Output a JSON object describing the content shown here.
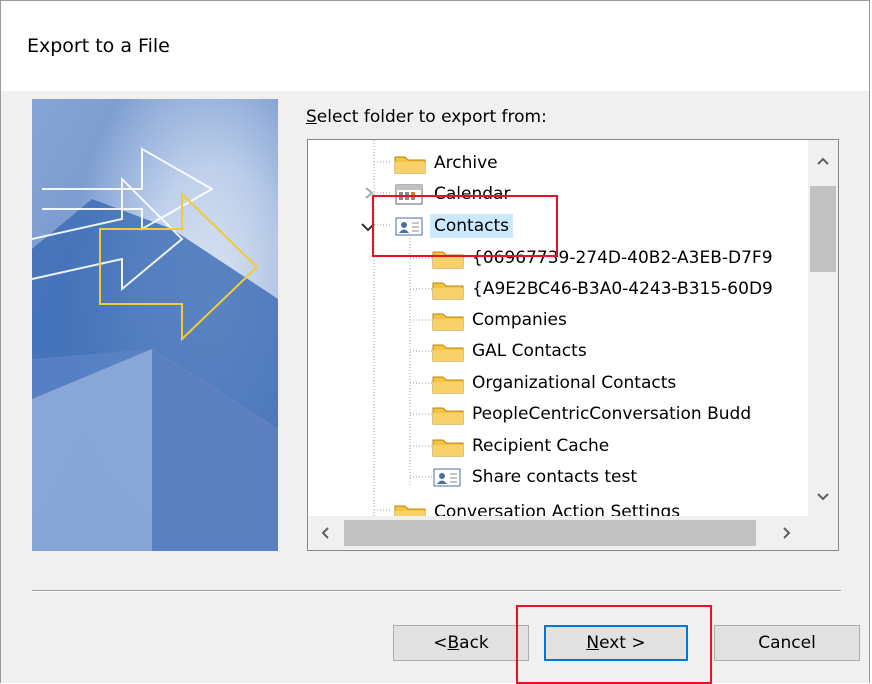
{
  "dialog": {
    "title": "Export to a File",
    "prompt_underlined": "S",
    "prompt_rest": "elect folder to export from:"
  },
  "tree": {
    "items": [
      {
        "label": "Archive",
        "icon": "folder-icon"
      },
      {
        "label": "Calendar",
        "icon": "calendar-icon"
      },
      {
        "label": "Contacts",
        "icon": "contacts-icon",
        "selected": true,
        "expanded": true
      },
      {
        "label": "{06967739-274D-40B2-A3EB-D7F9",
        "icon": "folder-icon"
      },
      {
        "label": "{A9E2BC46-B3A0-4243-B315-60D9",
        "icon": "folder-icon"
      },
      {
        "label": "Companies",
        "icon": "folder-icon"
      },
      {
        "label": "GAL Contacts",
        "icon": "folder-icon"
      },
      {
        "label": "Organizational Contacts",
        "icon": "folder-icon"
      },
      {
        "label": "PeopleCentricConversation Budd",
        "icon": "folder-icon"
      },
      {
        "label": "Recipient Cache",
        "icon": "folder-icon"
      },
      {
        "label": "Share contacts test",
        "icon": "contacts-icon"
      },
      {
        "label": "Conversation Action Settings",
        "icon": "folder-icon"
      }
    ]
  },
  "buttons": {
    "back_underlined": "B",
    "back_prefix": "< ",
    "back_rest": "ack",
    "next_underlined": "N",
    "next_rest": "ext >",
    "cancel": "Cancel"
  },
  "colors": {
    "selection": "#cce8ff",
    "highlight_box": "#e81123",
    "default_button_border": "#0078d7",
    "folder": "#f5c242"
  }
}
